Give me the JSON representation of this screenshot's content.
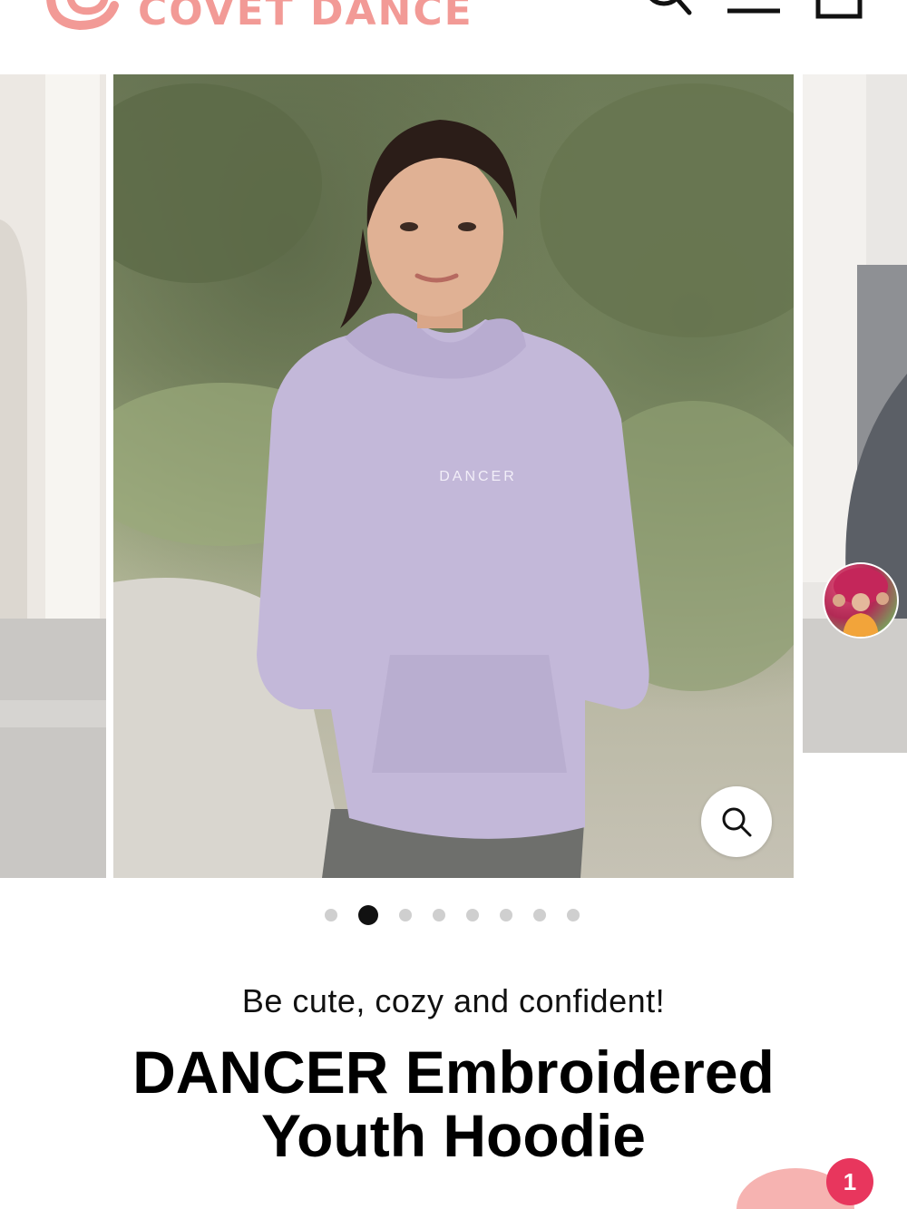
{
  "header": {
    "brand": "COVET DANCE",
    "brand_color": "#f29a96",
    "icons": [
      "search-icon",
      "menu-icon",
      "cart-icon"
    ]
  },
  "gallery": {
    "current_index": 2,
    "total_slides": 8,
    "current_image_alt": "DANCER",
    "zoom_icon": "zoom-icon"
  },
  "product": {
    "tagline": "Be cute, cozy and confident!",
    "title_line1": "DANCER Embroidered",
    "title_line2": "Youth Hoodie"
  },
  "chat": {
    "badge_count": "1",
    "badge_color": "#e8365d"
  }
}
